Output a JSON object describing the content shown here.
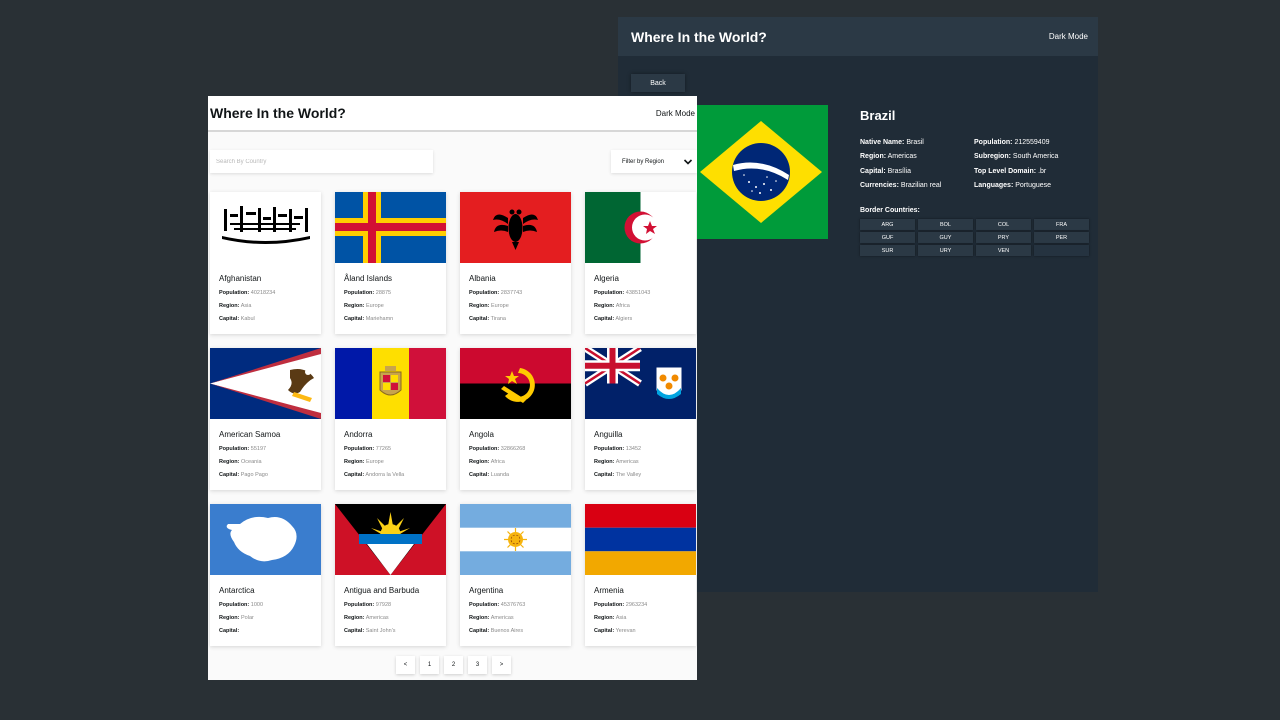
{
  "detail_window": {
    "title": "Where In the World?",
    "mode_toggle": "Dark Mode",
    "back_label": "Back",
    "country": {
      "name": "Brazil",
      "native_name_label": "Native Name:",
      "native_name": "Brasil",
      "population_label": "Population:",
      "population": "212559409",
      "region_label": "Region:",
      "region": "Americas",
      "subregion_label": "Subregion:",
      "subregion": "South America",
      "capital_label": "Capital:",
      "capital": "Brasília",
      "tld_label": "Top Level Domain:",
      "tld": ".br",
      "currencies_label": "Currencies:",
      "currencies": "Brazilian real",
      "languages_label": "Languages:",
      "languages": "Portuguese",
      "border_title": "Border Countries:",
      "borders": [
        "ARG",
        "BOL",
        "COL",
        "FRA",
        "GUF",
        "GUY",
        "PRY",
        "PER",
        "SUR",
        "URY",
        "VEN"
      ]
    }
  },
  "list_window": {
    "title": "Where In the World?",
    "mode_toggle": "Dark Mode",
    "search_placeholder": "Search By Country",
    "filter_label": "Filter by Region",
    "labels": {
      "population": "Population:",
      "region": "Region:",
      "capital": "Capital:"
    },
    "countries": [
      {
        "name": "Afghanistan",
        "population": "40218234",
        "region": "Asia",
        "capital": "Kabul",
        "flag": "afghanistan"
      },
      {
        "name": "Åland Islands",
        "population": "28875",
        "region": "Europe",
        "capital": "Mariehamn",
        "flag": "aland"
      },
      {
        "name": "Albania",
        "population": "2837743",
        "region": "Europe",
        "capital": "Tirana",
        "flag": "albania"
      },
      {
        "name": "Algeria",
        "population": "43851043",
        "region": "Africa",
        "capital": "Algiers",
        "flag": "algeria"
      },
      {
        "name": "American Samoa",
        "population": "55197",
        "region": "Oceania",
        "capital": "Pago Pago",
        "flag": "american-samoa"
      },
      {
        "name": "Andorra",
        "population": "77265",
        "region": "Europe",
        "capital": "Andorra la Vella",
        "flag": "andorra"
      },
      {
        "name": "Angola",
        "population": "32866268",
        "region": "Africa",
        "capital": "Luanda",
        "flag": "angola"
      },
      {
        "name": "Anguilla",
        "population": "13452",
        "region": "Americas",
        "capital": "The Valley",
        "flag": "anguilla"
      },
      {
        "name": "Antarctica",
        "population": "1000",
        "region": "Polar",
        "capital": "",
        "flag": "antarctica"
      },
      {
        "name": "Antigua and Barbuda",
        "population": "97928",
        "region": "Americas",
        "capital": "Saint John's",
        "flag": "antigua"
      },
      {
        "name": "Argentina",
        "population": "45376763",
        "region": "Americas",
        "capital": "Buenos Aires",
        "flag": "argentina"
      },
      {
        "name": "Armenia",
        "population": "2963234",
        "region": "Asia",
        "capital": "Yerevan",
        "flag": "armenia"
      }
    ],
    "pagination": {
      "prev": "<",
      "pages": [
        "1",
        "2",
        "3"
      ],
      "next": ">"
    }
  }
}
